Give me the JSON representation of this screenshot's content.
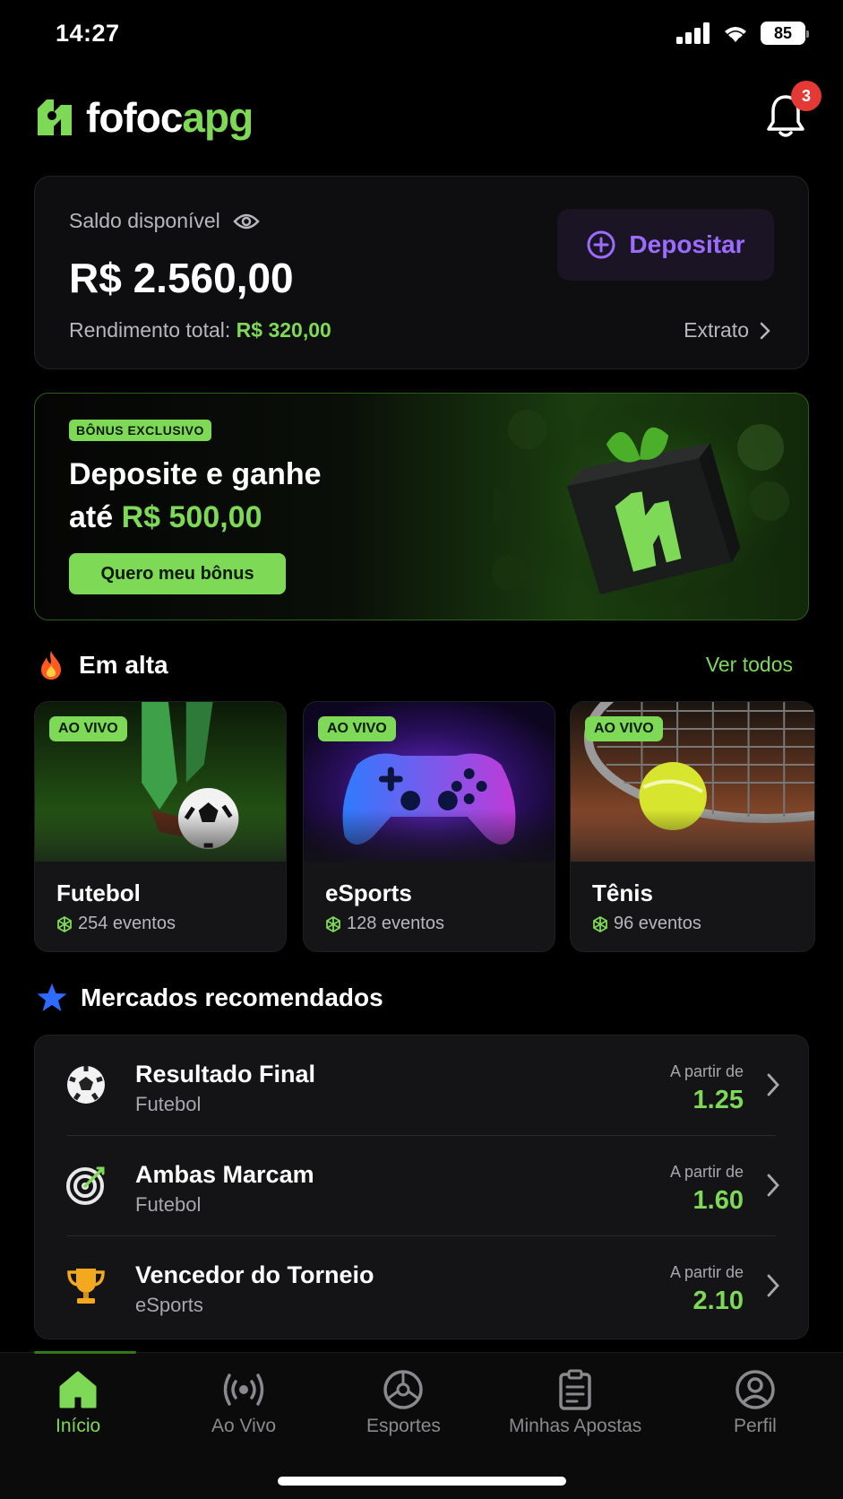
{
  "status_bar": {
    "time": "14:27",
    "battery": "85"
  },
  "header": {
    "logo_part1": "fofoc",
    "logo_part2": "apg",
    "notification_count": "3"
  },
  "balance": {
    "label": "Saldo disponível",
    "value": "R$ 2.560,00",
    "yield_label": "Rendimento total:",
    "yield_value": "R$ 320,00",
    "deposit_label": "Depositar",
    "statement_label": "Extrato"
  },
  "promo": {
    "badge": "BÔNUS EXCLUSIVO",
    "title_line1": "Deposite e ganhe",
    "title_line2_prefix": "até",
    "title_amount": "R$ 500,00",
    "cta": "Quero meu bônus"
  },
  "trending": {
    "title": "Em alta",
    "see_all": "Ver todos",
    "cards": [
      {
        "badge": "AO VIVO",
        "name": "Futebol",
        "count": "254 eventos"
      },
      {
        "badge": "AO VIVO",
        "name": "eSports",
        "count": "128 eventos"
      },
      {
        "badge": "AO VIVO",
        "name": "Tênis",
        "count": "96 eventos"
      }
    ]
  },
  "markets": {
    "title": "Mercados recomendados",
    "items": [
      {
        "icon": "soccer-ball-icon",
        "title": "Resultado Final",
        "sport": "Futebol",
        "from": "A partir de",
        "odd": "1.25"
      },
      {
        "icon": "target-icon",
        "title": "Ambas Marcam",
        "sport": "Futebol",
        "from": "A partir de",
        "odd": "1.60"
      },
      {
        "icon": "trophy-icon",
        "title": "Vencedor do Torneio",
        "sport": "eSports",
        "from": "A partir de",
        "odd": "2.10"
      }
    ]
  },
  "nav": {
    "items": [
      {
        "label": "Início",
        "icon": "home-icon",
        "active": true
      },
      {
        "label": "Ao Vivo",
        "icon": "live-broadcast-icon"
      },
      {
        "label": "Esportes",
        "icon": "sports-wheel-icon"
      },
      {
        "label": "Minhas Apostas",
        "icon": "clipboard-icon"
      },
      {
        "label": "Perfil",
        "icon": "profile-icon"
      }
    ]
  },
  "colors": {
    "accent": "#7ed957",
    "deposit": "#9b6cff",
    "badge_red": "#e53935",
    "background": "#000000"
  }
}
